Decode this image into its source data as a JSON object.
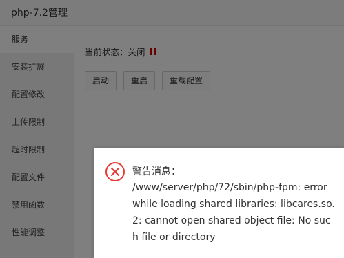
{
  "window": {
    "title": "php-7.2管理"
  },
  "sidebar": {
    "items": [
      {
        "label": "服务"
      },
      {
        "label": "安装扩展"
      },
      {
        "label": "配置修改"
      },
      {
        "label": "上传限制"
      },
      {
        "label": "超时限制"
      },
      {
        "label": "配置文件"
      },
      {
        "label": "禁用函数"
      },
      {
        "label": "性能调整"
      }
    ]
  },
  "main": {
    "status_label": "当前状态：",
    "status_value": "关闭",
    "status_color": "#d10000",
    "buttons": {
      "start": "启动",
      "restart": "重启",
      "reload": "重载配置"
    }
  },
  "dialog": {
    "icon": "error-circle-icon",
    "title": "警告消息：",
    "body": "/www/server/php/72/sbin/php-fpm: error while loading shared libraries: libcares.so.2: cannot open shared object file: No such file or directory"
  }
}
